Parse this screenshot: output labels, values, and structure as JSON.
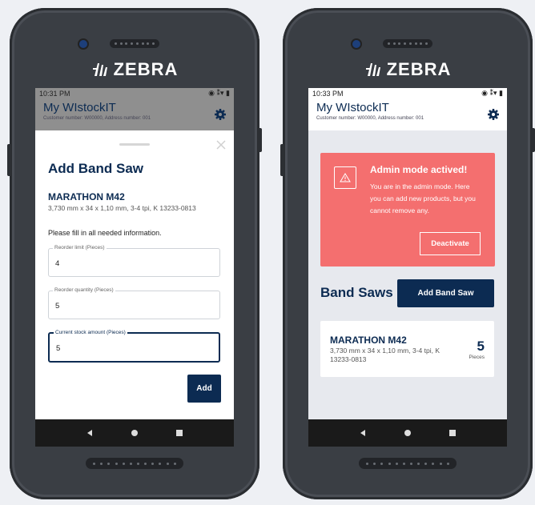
{
  "brand": "ZEBRA",
  "app": {
    "title": "My WIstockIT",
    "subtitle": "Customer number: W00000, Address number: 001"
  },
  "left_screen": {
    "time": "10:31 PM",
    "sheet_title": "Add Band Saw",
    "product_name": "MARATHON M42",
    "product_desc": "3,730 mm x 34 x 1,10 mm, 3-4 tpi, K   13233-0813",
    "instruction": "Please fill in all needed information.",
    "fields": [
      {
        "label": "Reorder limit (Pieces)",
        "value": "4"
      },
      {
        "label": "Reorder quantity (Pieces)",
        "value": "5"
      },
      {
        "label": "Current stock amount (Pieces)",
        "value": "5"
      }
    ],
    "add_label": "Add"
  },
  "right_screen": {
    "time": "10:33 PM",
    "alert_title": "Admin mode actived!",
    "alert_body": "You are in the admin mode. Here you can add new products, but you cannot remove any.",
    "deactivate_label": "Deactivate",
    "section_title": "Band Saws",
    "add_saw_label": "Add Band Saw",
    "card": {
      "name": "MARATHON M42",
      "desc": "3,730 mm x 34 x 1,10 mm, 3-4 tpi, K 13233-0813",
      "count": "5",
      "unit": "Pieces"
    }
  },
  "colors": {
    "primary": "#0c2b52",
    "alert": "#f46f6f",
    "device": "#3a3e44"
  }
}
